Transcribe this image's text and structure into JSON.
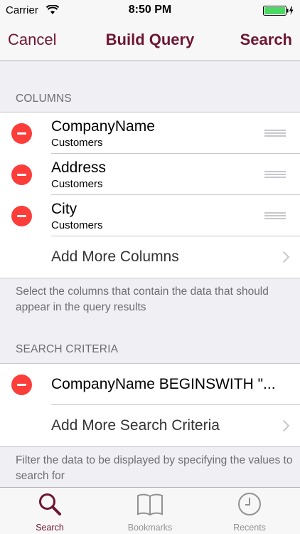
{
  "status_bar": {
    "carrier": "Carrier",
    "time": "8:50 PM"
  },
  "nav": {
    "cancel_label": "Cancel",
    "title": "Build Query",
    "search_label": "Search"
  },
  "columns": {
    "header": "COLUMNS",
    "items": [
      {
        "title": "CompanyName",
        "subtitle": "Customers"
      },
      {
        "title": "Address",
        "subtitle": "Customers"
      },
      {
        "title": "City",
        "subtitle": "Customers"
      }
    ],
    "add_label": "Add More Columns",
    "footer": "Select the columns that contain the data that should appear in the query results"
  },
  "criteria": {
    "header": "SEARCH CRITERIA",
    "items": [
      {
        "title": "CompanyName BEGINSWITH \"..."
      }
    ],
    "add_label": "Add More Search Criteria",
    "footer": "Filter the data to be displayed by specifying the values to search for"
  },
  "tabs": [
    {
      "label": "Search",
      "icon": "search-icon",
      "active": true
    },
    {
      "label": "Bookmarks",
      "icon": "bookmarks-icon",
      "active": false
    },
    {
      "label": "Recents",
      "icon": "clock-icon",
      "active": false
    }
  ],
  "colors": {
    "accent": "#6d1634",
    "delete": "#fc3d39",
    "battery": "#4cd964"
  }
}
